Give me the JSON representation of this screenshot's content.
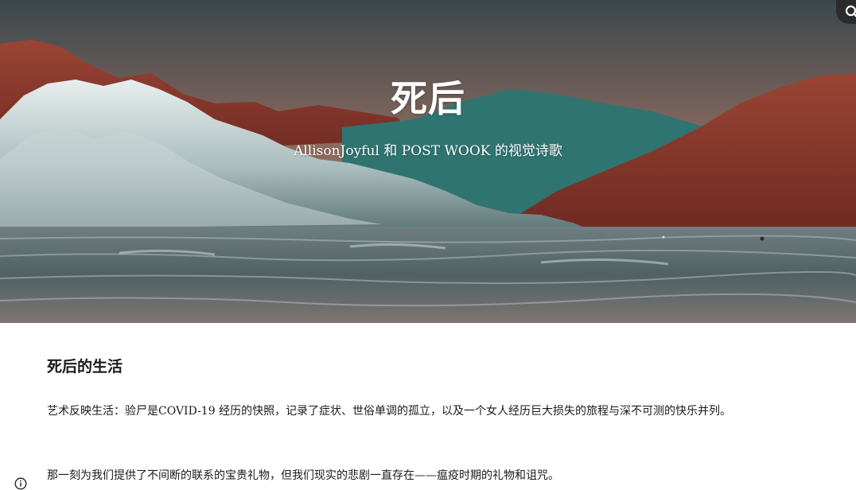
{
  "header": {
    "site_title": "死后",
    "tagline": "AllisonJoyful 和 POST WOOK 的视觉诗歌",
    "hero_image": "surreal-landscape-mountains-clouds-sea"
  },
  "toolbar": {
    "search_icon": "search-icon"
  },
  "post": {
    "title": "死后的生活",
    "paragraphs": [
      "艺术反映生活：验尸是COVID-19 经历的快照，记录了症状、世俗单调的孤立，以及一个女人经历巨大损失的旅程与深不可测的快乐并列。",
      "那一刻为我们提供了不间断的联系的宝贵礼物，但我们现实的悲剧一直存在——瘟疫时期的礼物和诅咒。"
    ]
  },
  "footer": {
    "info_icon": "info-icon"
  },
  "colors": {
    "sky_top": "#3f4a50",
    "sky_bottom": "#b27a63",
    "mountain_red": "#8e3a2c",
    "mountain_teal": "#2f7470",
    "sea": "#56686a",
    "text": "#1a1a1a"
  }
}
